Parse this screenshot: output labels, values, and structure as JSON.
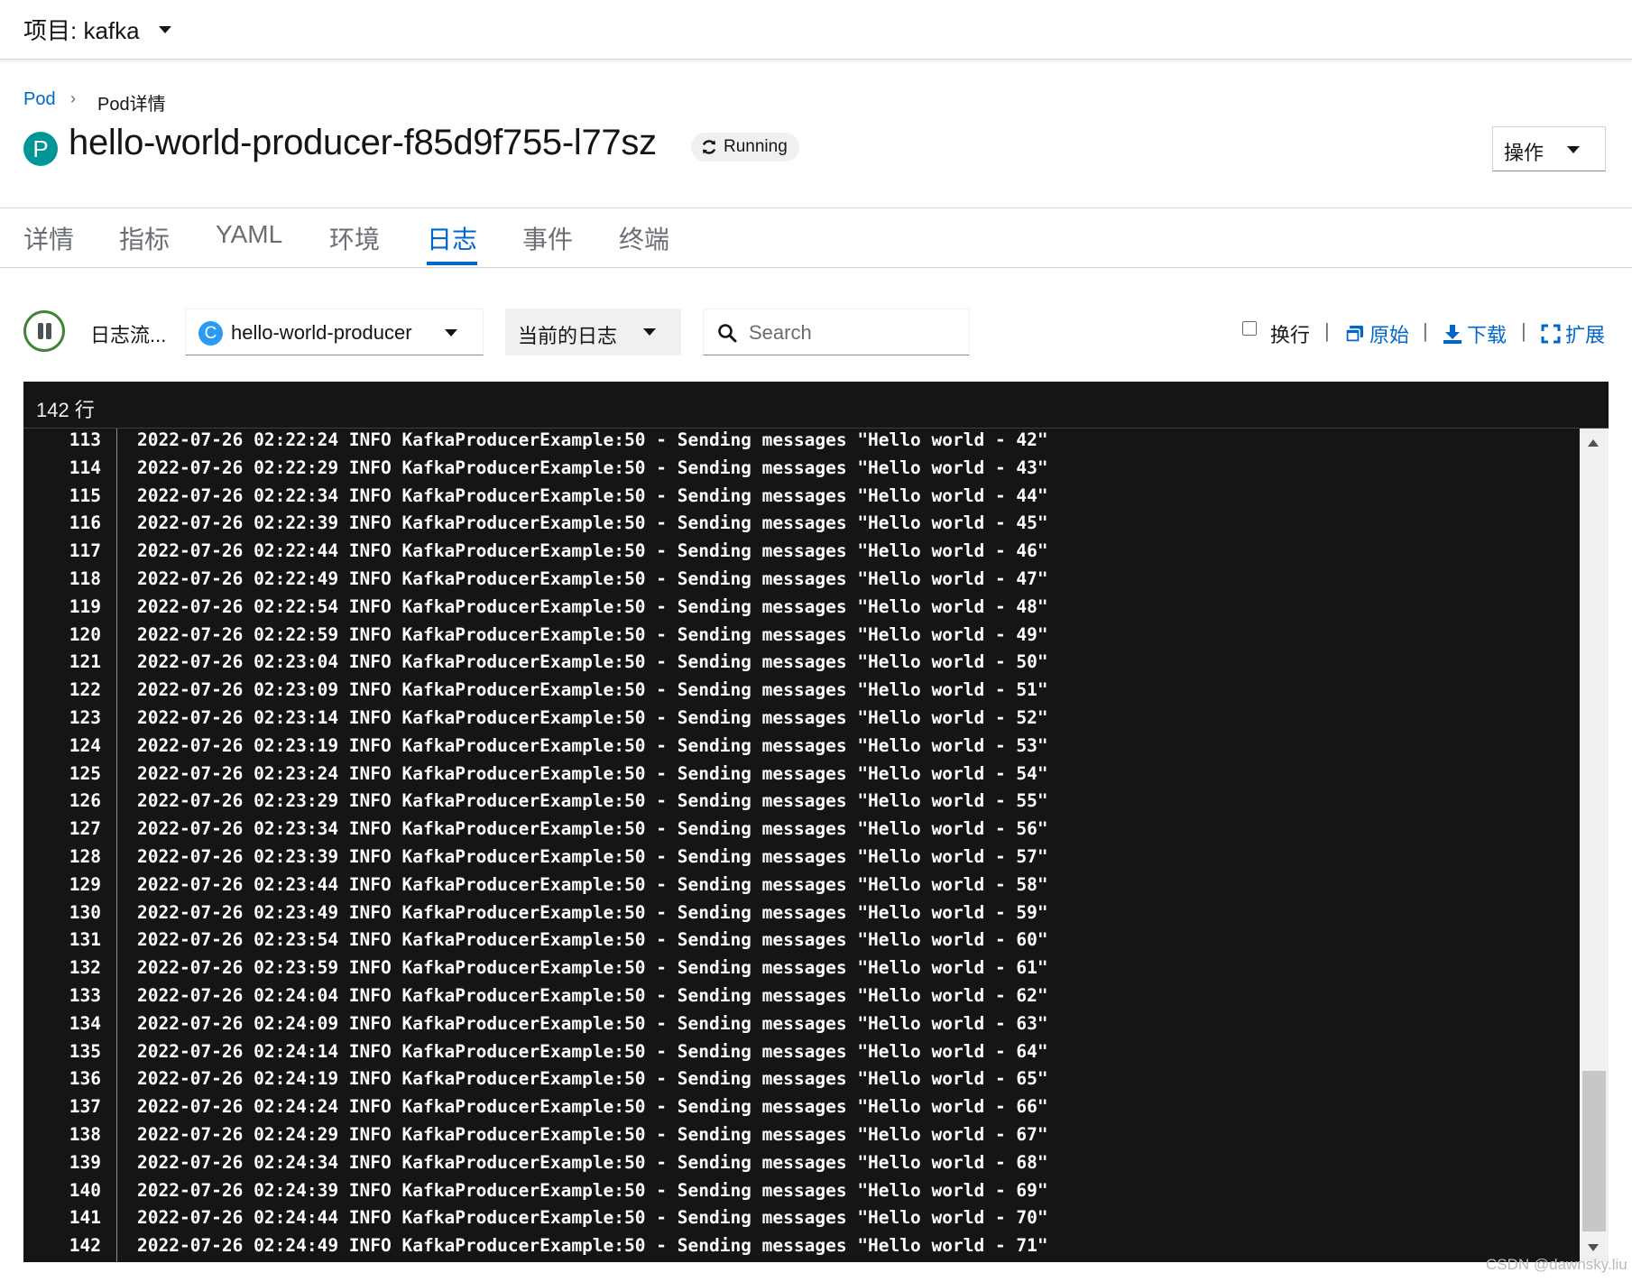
{
  "project": {
    "label": "项目: kafka"
  },
  "breadcrumb": {
    "parent": "Pod",
    "separator": "›",
    "current": "Pod详情"
  },
  "pod": {
    "badge": "P",
    "name": "hello-world-producer-f85d9f755-l77sz",
    "status": "Running"
  },
  "actions": {
    "label": "操作"
  },
  "tabs": [
    {
      "label": "详情",
      "active": false
    },
    {
      "label": "指标",
      "active": false
    },
    {
      "label": "YAML",
      "active": false
    },
    {
      "label": "环境",
      "active": false
    },
    {
      "label": "日志",
      "active": true
    },
    {
      "label": "事件",
      "active": false
    },
    {
      "label": "终端",
      "active": false
    }
  ],
  "toolbar": {
    "stream_label": "日志流...",
    "container": {
      "badge": "C",
      "name": "hello-world-producer"
    },
    "log_type": "当前的日志",
    "search_placeholder": "Search",
    "wrap_label": "换行",
    "separator": "|",
    "raw_label": "原始",
    "download_label": "下载",
    "expand_label": "扩展"
  },
  "log": {
    "line_count": "142 行",
    "lines": [
      {
        "n": "113",
        "text": "2022-07-26 02:22:24 INFO KafkaProducerExample:50 - Sending messages \"Hello world - 42\""
      },
      {
        "n": "114",
        "text": "2022-07-26 02:22:29 INFO KafkaProducerExample:50 - Sending messages \"Hello world - 43\""
      },
      {
        "n": "115",
        "text": "2022-07-26 02:22:34 INFO KafkaProducerExample:50 - Sending messages \"Hello world - 44\""
      },
      {
        "n": "116",
        "text": "2022-07-26 02:22:39 INFO KafkaProducerExample:50 - Sending messages \"Hello world - 45\""
      },
      {
        "n": "117",
        "text": "2022-07-26 02:22:44 INFO KafkaProducerExample:50 - Sending messages \"Hello world - 46\""
      },
      {
        "n": "118",
        "text": "2022-07-26 02:22:49 INFO KafkaProducerExample:50 - Sending messages \"Hello world - 47\""
      },
      {
        "n": "119",
        "text": "2022-07-26 02:22:54 INFO KafkaProducerExample:50 - Sending messages \"Hello world - 48\""
      },
      {
        "n": "120",
        "text": "2022-07-26 02:22:59 INFO KafkaProducerExample:50 - Sending messages \"Hello world - 49\""
      },
      {
        "n": "121",
        "text": "2022-07-26 02:23:04 INFO KafkaProducerExample:50 - Sending messages \"Hello world - 50\""
      },
      {
        "n": "122",
        "text": "2022-07-26 02:23:09 INFO KafkaProducerExample:50 - Sending messages \"Hello world - 51\""
      },
      {
        "n": "123",
        "text": "2022-07-26 02:23:14 INFO KafkaProducerExample:50 - Sending messages \"Hello world - 52\""
      },
      {
        "n": "124",
        "text": "2022-07-26 02:23:19 INFO KafkaProducerExample:50 - Sending messages \"Hello world - 53\""
      },
      {
        "n": "125",
        "text": "2022-07-26 02:23:24 INFO KafkaProducerExample:50 - Sending messages \"Hello world - 54\""
      },
      {
        "n": "126",
        "text": "2022-07-26 02:23:29 INFO KafkaProducerExample:50 - Sending messages \"Hello world - 55\""
      },
      {
        "n": "127",
        "text": "2022-07-26 02:23:34 INFO KafkaProducerExample:50 - Sending messages \"Hello world - 56\""
      },
      {
        "n": "128",
        "text": "2022-07-26 02:23:39 INFO KafkaProducerExample:50 - Sending messages \"Hello world - 57\""
      },
      {
        "n": "129",
        "text": "2022-07-26 02:23:44 INFO KafkaProducerExample:50 - Sending messages \"Hello world - 58\""
      },
      {
        "n": "130",
        "text": "2022-07-26 02:23:49 INFO KafkaProducerExample:50 - Sending messages \"Hello world - 59\""
      },
      {
        "n": "131",
        "text": "2022-07-26 02:23:54 INFO KafkaProducerExample:50 - Sending messages \"Hello world - 60\""
      },
      {
        "n": "132",
        "text": "2022-07-26 02:23:59 INFO KafkaProducerExample:50 - Sending messages \"Hello world - 61\""
      },
      {
        "n": "133",
        "text": "2022-07-26 02:24:04 INFO KafkaProducerExample:50 - Sending messages \"Hello world - 62\""
      },
      {
        "n": "134",
        "text": "2022-07-26 02:24:09 INFO KafkaProducerExample:50 - Sending messages \"Hello world - 63\""
      },
      {
        "n": "135",
        "text": "2022-07-26 02:24:14 INFO KafkaProducerExample:50 - Sending messages \"Hello world - 64\""
      },
      {
        "n": "136",
        "text": "2022-07-26 02:24:19 INFO KafkaProducerExample:50 - Sending messages \"Hello world - 65\""
      },
      {
        "n": "137",
        "text": "2022-07-26 02:24:24 INFO KafkaProducerExample:50 - Sending messages \"Hello world - 66\""
      },
      {
        "n": "138",
        "text": "2022-07-26 02:24:29 INFO KafkaProducerExample:50 - Sending messages \"Hello world - 67\""
      },
      {
        "n": "139",
        "text": "2022-07-26 02:24:34 INFO KafkaProducerExample:50 - Sending messages \"Hello world - 68\""
      },
      {
        "n": "140",
        "text": "2022-07-26 02:24:39 INFO KafkaProducerExample:50 - Sending messages \"Hello world - 69\""
      },
      {
        "n": "141",
        "text": "2022-07-26 02:24:44 INFO KafkaProducerExample:50 - Sending messages \"Hello world - 70\""
      },
      {
        "n": "142",
        "text": "2022-07-26 02:24:49 INFO KafkaProducerExample:50 - Sending messages \"Hello world - 71\""
      }
    ]
  },
  "watermark": "CSDN @dawnsky.liu",
  "colors": {
    "accent": "#0066cc",
    "pod_badge": "#009596",
    "container_badge": "#2b9af3",
    "stream_active": "#3e8635",
    "log_bg": "#151515"
  },
  "icons": {
    "status": "sync-icon",
    "pause": "pause-icon",
    "search": "search-icon",
    "raw": "window-icon",
    "download": "download-icon",
    "expand": "expand-icon"
  }
}
